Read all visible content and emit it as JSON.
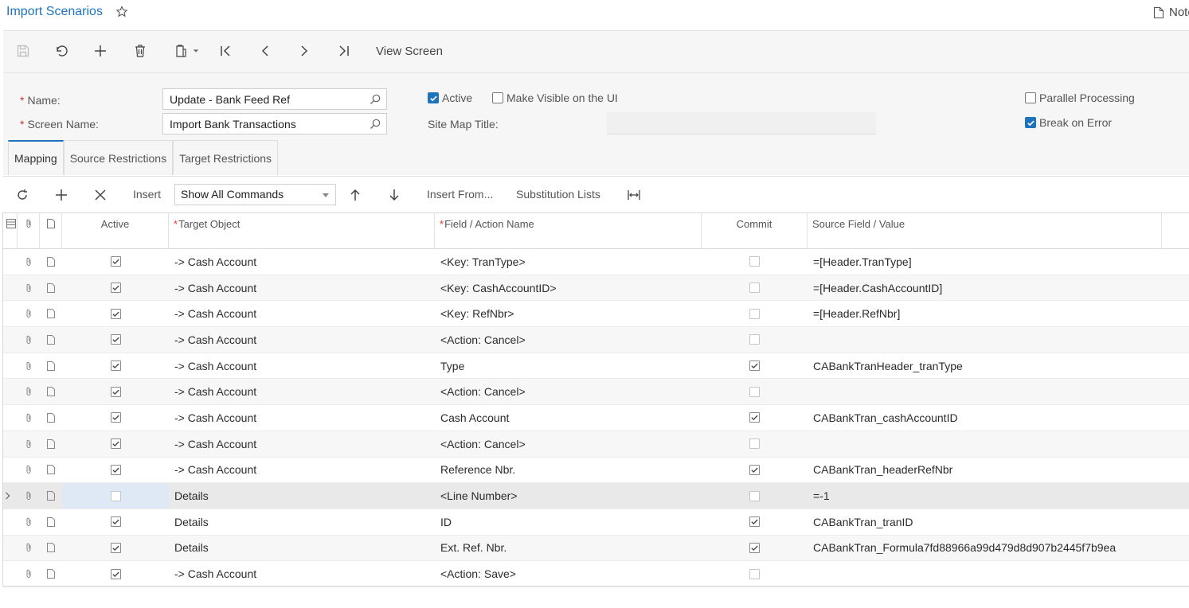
{
  "header": {
    "title": "Import Scenarios",
    "notes_label": "Notes"
  },
  "toolbar": {
    "view_screen_label": "View Screen"
  },
  "form": {
    "name_label": "Name:",
    "name_value": "Update - Bank Feed Ref",
    "screen_name_label": "Screen Name:",
    "screen_name_value": "Import Bank Transactions",
    "active_label": "Active",
    "active_checked": true,
    "visible_ui_label": "Make Visible on the UI",
    "visible_ui_checked": false,
    "site_map_title_label": "Site Map Title:",
    "site_map_title_value": "",
    "parallel_label": "Parallel Processing",
    "parallel_checked": false,
    "break_label": "Break on Error",
    "break_checked": true
  },
  "tabs": [
    {
      "label": "Mapping",
      "active": true
    },
    {
      "label": "Source Restrictions",
      "active": false
    },
    {
      "label": "Target Restrictions",
      "active": false
    }
  ],
  "grid_toolbar": {
    "insert_label": "Insert",
    "commands_selected": "Show All Commands",
    "insert_from_label": "Insert From...",
    "substitution_label": "Substitution Lists"
  },
  "grid": {
    "columns": {
      "active": "Active",
      "target_object": "Target Object",
      "field_action": "Field / Action Name",
      "commit": "Commit",
      "source_field": "Source Field / Value"
    },
    "rows": [
      {
        "active": true,
        "target": "-> Cash Account",
        "field": "<Key: TranType>",
        "commit": false,
        "source": "=[Header.TranType]"
      },
      {
        "active": true,
        "target": "-> Cash Account",
        "field": "<Key: CashAccountID>",
        "commit": false,
        "source": "=[Header.CashAccountID]"
      },
      {
        "active": true,
        "target": "-> Cash Account",
        "field": "<Key: RefNbr>",
        "commit": false,
        "source": "=[Header.RefNbr]"
      },
      {
        "active": true,
        "target": "-> Cash Account",
        "field": "<Action: Cancel>",
        "commit": false,
        "source": ""
      },
      {
        "active": true,
        "target": "-> Cash Account",
        "field": "Type",
        "commit": true,
        "source": "CABankTranHeader_tranType"
      },
      {
        "active": true,
        "target": "-> Cash Account",
        "field": "<Action: Cancel>",
        "commit": false,
        "source": ""
      },
      {
        "active": true,
        "target": "-> Cash Account",
        "field": "Cash Account",
        "commit": true,
        "source": "CABankTran_cashAccountID"
      },
      {
        "active": true,
        "target": "-> Cash Account",
        "field": "<Action: Cancel>",
        "commit": false,
        "source": ""
      },
      {
        "active": true,
        "target": "-> Cash Account",
        "field": "Reference Nbr.",
        "commit": true,
        "source": "CABankTran_headerRefNbr"
      },
      {
        "active": false,
        "target": "Details",
        "field": "<Line Number>",
        "commit": false,
        "source": "=-1",
        "selected": true
      },
      {
        "active": true,
        "target": "Details",
        "field": "ID",
        "commit": true,
        "source": "CABankTran_tranID"
      },
      {
        "active": true,
        "target": "Details",
        "field": "Ext. Ref. Nbr.",
        "commit": true,
        "source": "CABankTran_Formula7fd88966a99d479d8d907b2445f7b9ea"
      },
      {
        "active": true,
        "target": "-> Cash Account",
        "field": "<Action: Save>",
        "commit": false,
        "source": ""
      }
    ]
  },
  "colors": {
    "accent": "#1e73be",
    "required": "#dd3333"
  }
}
